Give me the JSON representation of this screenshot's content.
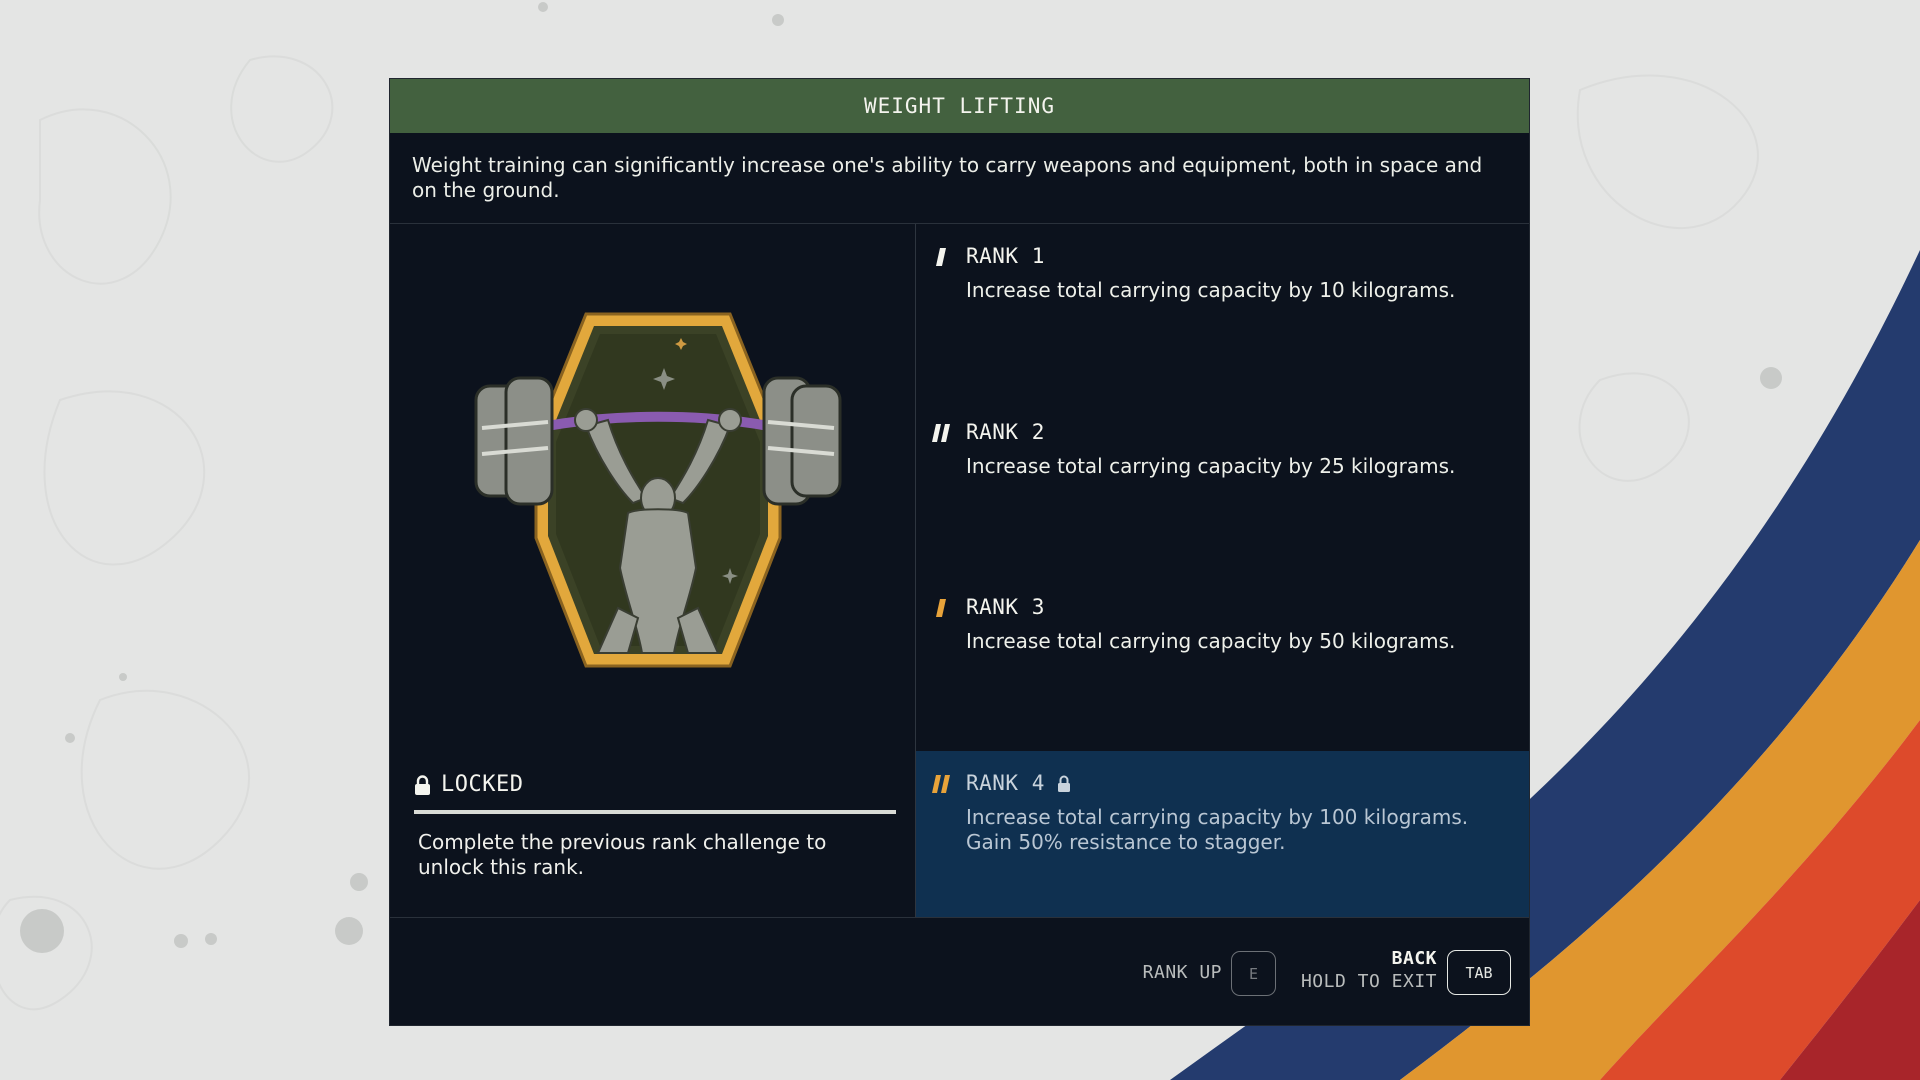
{
  "skill": {
    "title": "WEIGHT LIFTING",
    "description": "Weight training can significantly increase one's ability to carry weapons and equipment, both in space and on the ground.",
    "badge_icon": "weightlifter-patch-icon",
    "status": {
      "label": "LOCKED",
      "message": "Complete the previous rank challenge to unlock this rank."
    },
    "ranks": [
      {
        "title": "RANK 1",
        "description": "Increase total carrying capacity by 10 kilograms.",
        "unlocked": true
      },
      {
        "title": "RANK 2",
        "description": "Increase total carrying capacity by 25 kilograms.",
        "unlocked": true
      },
      {
        "title": "RANK 3",
        "description": "Increase total carrying capacity by 50 kilograms.",
        "unlocked": true
      },
      {
        "title": "RANK 4",
        "description": "Increase total carrying capacity by 100 kilograms. Gain 50% resistance to stagger.",
        "unlocked": false,
        "selected": true
      }
    ]
  },
  "footer": {
    "rank_up_label": "RANK UP",
    "rank_up_key": "E",
    "back_label": "BACK",
    "hold_exit_label": "HOLD TO EXIT",
    "back_key": "TAB"
  },
  "colors": {
    "title_bar": "#43613f",
    "panel_bg": "#0c121d",
    "selected_row": "#0f3050",
    "accent_orange": "#e8a33a",
    "badge_gold": "#e2a83c",
    "stripe_blue": "#243b6e",
    "stripe_orange": "#e0962f",
    "stripe_red": "#dd4a2b"
  }
}
